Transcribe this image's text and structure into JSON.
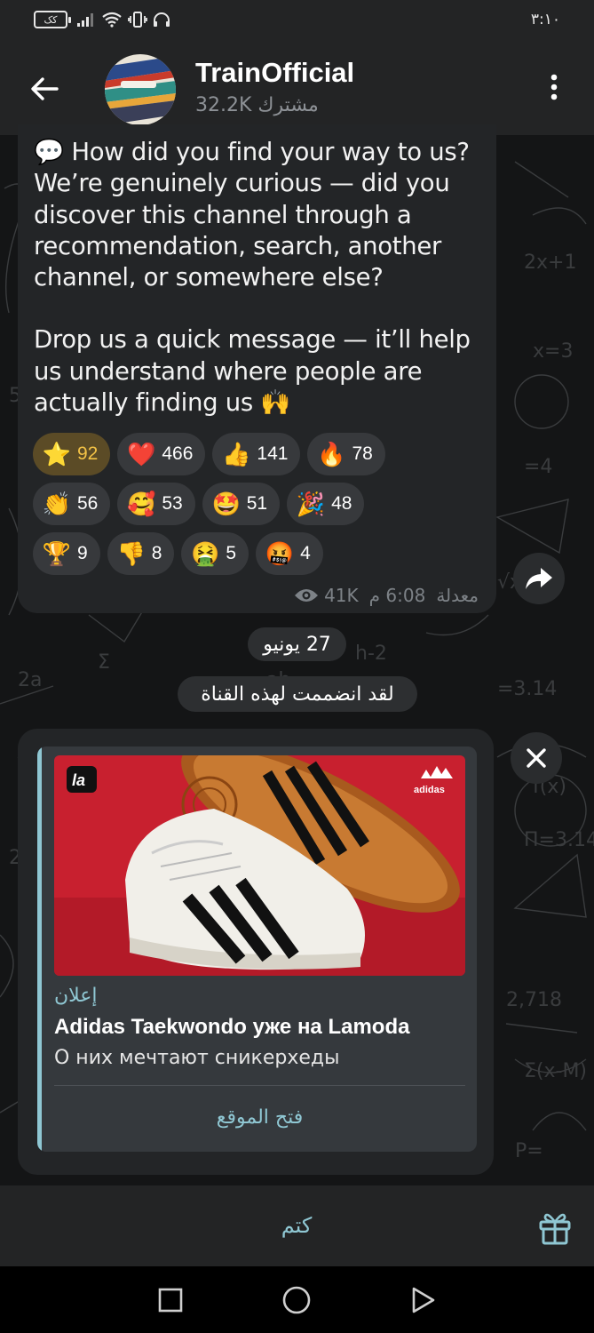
{
  "status_bar": {
    "battery": "کک",
    "time": "٣:١٠"
  },
  "header": {
    "title": "TrainOfficial",
    "subscribers": "32.2K مشترك"
  },
  "message": {
    "paragraph_1": "💬 How did you find your way to us? We’re genuinely curious — did you discover this channel through a recommendation, search, another channel, or somewhere else?",
    "paragraph_2": "Drop us a quick message — it’ll help us understand where people are actually finding us 🙌",
    "reactions": [
      {
        "emoji": "⭐",
        "count": "92",
        "active": true
      },
      {
        "emoji": "❤️",
        "count": "466"
      },
      {
        "emoji": "👍",
        "count": "141"
      },
      {
        "emoji": "🔥",
        "count": "78"
      },
      {
        "emoji": "👏",
        "count": "56"
      },
      {
        "emoji": "🥰",
        "count": "53"
      },
      {
        "emoji": "🤩",
        "count": "51"
      },
      {
        "emoji": "🎉",
        "count": "48"
      },
      {
        "emoji": "🏆",
        "count": "9"
      },
      {
        "emoji": "👎",
        "count": "8"
      },
      {
        "emoji": "🤮",
        "count": "5"
      },
      {
        "emoji": "🤬",
        "count": "4"
      }
    ],
    "views": "41K",
    "time": "6:08 م",
    "edited": "معدلة"
  },
  "date_separator": "27 يونيو",
  "service_message": "لقد انضممت لهذه القناة",
  "ad": {
    "label": "إعلان",
    "title": "Adidas Taekwondo уже на Lamoda",
    "description": "О них мечтают сникерхеды",
    "button": "فتح الموقع",
    "image_logo_left": "la",
    "image_logo_right": "adidas"
  },
  "bottom_bar": {
    "mute_label": "كتم"
  },
  "colors": {
    "accent": "#8fc7d3",
    "bubble": "#232527",
    "active_reaction": "#f3c246",
    "ad_background": "#c8202f"
  }
}
